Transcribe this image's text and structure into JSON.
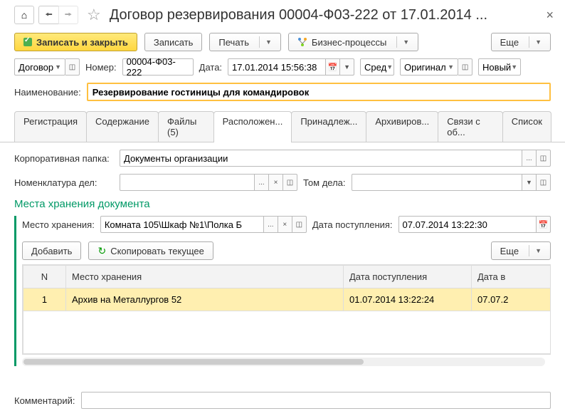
{
  "header": {
    "title": "Договор резервирования 00004-Ф03-222 от 17.01.2014 ..."
  },
  "toolbar": {
    "save_close": "Записать и закрыть",
    "save": "Записать",
    "print": "Печать",
    "bp": "Бизнес-процессы",
    "more": "Еще"
  },
  "meta": {
    "type_label": "Договор",
    "num_label": "Номер:",
    "num": "00004-Ф03-222",
    "date_label": "Дата:",
    "date": "17.01.2014 15:56:38",
    "priority": "Сред",
    "original": "Оригинал",
    "status": "Новый"
  },
  "name_label": "Наименование:",
  "name": "Резервирование гостиницы для командировок",
  "tabs": {
    "t1": "Регистрация",
    "t2": "Содержание",
    "t3": "Файлы (5)",
    "t4": "Расположен...",
    "t5": "Принадлеж...",
    "t6": "Архивиров...",
    "t7": "Связи с об...",
    "t8": "Список"
  },
  "loc": {
    "corp_label": "Корпоративная папка:",
    "corp": "Документы организации",
    "nom_label": "Номенклатура дел:",
    "tom_label": "Том дела:",
    "section": "Места хранения документа",
    "place_label": "Место хранения:",
    "place": "Комната 105\\Шкаф №1\\Полка Б",
    "date_in_label": "Дата поступления:",
    "date_in": "07.07.2014 13:22:30",
    "add": "Добавить",
    "copy": "Скопировать текущее",
    "more": "Еще"
  },
  "table": {
    "h_n": "N",
    "h_place": "Место хранения",
    "h_date": "Дата поступления",
    "h_out": "Дата в",
    "r1_n": "1",
    "r1_place": "Архив на Металлургов 52",
    "r1_date": "01.07.2014 13:22:24",
    "r1_out": "07.07.2"
  },
  "comm_label": "Комментарий:"
}
